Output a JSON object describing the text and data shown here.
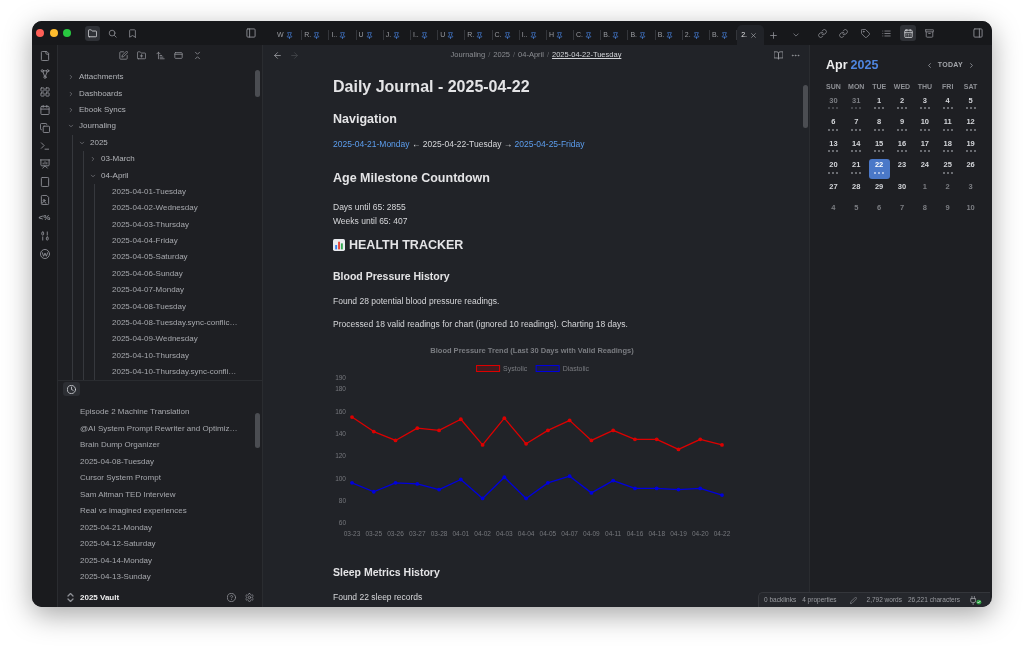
{
  "title_bar": {
    "sidebar_tabs": [
      {
        "selected": true
      },
      {
        "selected": false
      },
      {
        "selected": false
      }
    ],
    "tabs": [
      {
        "label": "W",
        "pinned": true,
        "selected": false
      },
      {
        "label": "R.",
        "pinned": true,
        "selected": false
      },
      {
        "label": "I..",
        "pinned": true,
        "selected": false
      },
      {
        "label": "U",
        "pinned": true,
        "selected": false
      },
      {
        "label": "J.",
        "pinned": true,
        "selected": false
      },
      {
        "label": "I..",
        "pinned": true,
        "selected": false
      },
      {
        "label": "U",
        "pinned": true,
        "selected": false
      },
      {
        "label": "R.",
        "pinned": true,
        "selected": false
      },
      {
        "label": "C.",
        "pinned": true,
        "selected": false
      },
      {
        "label": "I..",
        "pinned": true,
        "selected": false
      },
      {
        "label": "H",
        "pinned": true,
        "selected": false
      },
      {
        "label": "C.",
        "pinned": true,
        "selected": false
      },
      {
        "label": "B.",
        "pinned": true,
        "selected": false
      },
      {
        "label": "B.",
        "pinned": true,
        "selected": false
      },
      {
        "label": "B.",
        "pinned": true,
        "selected": false
      },
      {
        "label": "2.",
        "pinned": true,
        "selected": false
      },
      {
        "label": "B.",
        "pinned": true,
        "selected": false
      },
      {
        "label": "2.",
        "pinned": false,
        "selected": true
      }
    ],
    "right_tabs": [
      {
        "selected": false
      },
      {
        "selected": false
      },
      {
        "selected": false
      },
      {
        "selected": false
      },
      {
        "selected": true
      },
      {
        "selected": false
      }
    ]
  },
  "breadcrumb_bar": {
    "back_enabled": true,
    "forward_enabled": false,
    "items": [
      {
        "label": "Journaling",
        "current": false,
        "separator": "/"
      },
      {
        "label": "2025",
        "current": false,
        "separator": "/"
      },
      {
        "label": "04-April",
        "current": false,
        "separator": "/"
      },
      {
        "label": "2025-04-22-Tuesday",
        "current": true
      }
    ]
  },
  "ribbon": {
    "template_glyph": "<%"
  },
  "file_tree": [
    {
      "label": "Attachments",
      "kind": "folder",
      "expanded": false
    },
    {
      "label": "Dashboards",
      "kind": "folder",
      "expanded": false
    },
    {
      "label": "Ebook Syncs",
      "kind": "folder",
      "expanded": false
    },
    {
      "label": "Journaling",
      "kind": "folder",
      "expanded": true,
      "children": [
        {
          "label": "2025",
          "kind": "folder",
          "expanded": true,
          "children": [
            {
              "label": "03-March",
              "kind": "folder",
              "expanded": false
            },
            {
              "label": "04-April",
              "kind": "folder",
              "expanded": true,
              "children": [
                {
                  "label": "2025-04-01-Tuesday",
                  "kind": "file"
                },
                {
                  "label": "2025-04-02-Wednesday",
                  "kind": "file"
                },
                {
                  "label": "2025-04-03-Thursday",
                  "kind": "file"
                },
                {
                  "label": "2025-04-04-Friday",
                  "kind": "file"
                },
                {
                  "label": "2025-04-05-Saturday",
                  "kind": "file"
                },
                {
                  "label": "2025-04-06-Sunday",
                  "kind": "file"
                },
                {
                  "label": "2025-04-07-Monday",
                  "kind": "file"
                },
                {
                  "label": "2025-04-08-Tuesday",
                  "kind": "file"
                },
                {
                  "label": "2025-04-08-Tuesday.sync-conflic…",
                  "kind": "file"
                },
                {
                  "label": "2025-04-09-Wednesday",
                  "kind": "file"
                },
                {
                  "label": "2025-04-10-Thursday",
                  "kind": "file"
                },
                {
                  "label": "2025-04-10-Thursday.sync-confli…",
                  "kind": "file"
                }
              ]
            }
          ]
        }
      ]
    }
  ],
  "recent_files": {
    "tab_selected": true,
    "items": [
      "Episode 2 Machine Translation",
      "@AI System Prompt Rewriter and Optimiz…",
      "Brain Dump Organizer",
      "2025-04-08-Tuesday",
      "Cursor System Prompt",
      "Sam Altman TED Interview",
      "Real vs imagined experiences",
      "2025-04-21-Monday",
      "2025-04-12-Saturday",
      "2025-04-14-Monday",
      "2025-04-13-Sunday"
    ]
  },
  "vault": {
    "name": "2025 Vault"
  },
  "note": {
    "title": "Daily Journal - 2025-04-22",
    "blocks": [
      {
        "kind": "h2",
        "text": "Navigation"
      },
      {
        "kind": "nav",
        "prev": "2025-04-21-Monday",
        "middle": "← 2025-04-22-Tuesday →",
        "next": "2025-04-25-Friday"
      },
      {
        "kind": "h2",
        "text": "Age Milestone Countdown"
      },
      {
        "kind": "lines",
        "lines": [
          "Days until 65: 2855",
          "Weeks until 65: 407"
        ]
      },
      {
        "kind": "icon_heading",
        "text": "HEALTH TRACKER"
      },
      {
        "kind": "h3",
        "text": "Blood Pressure History"
      },
      {
        "kind": "p",
        "text": "Found 28 potential blood pressure readings."
      },
      {
        "kind": "p",
        "text": "Processed 18 valid readings for chart (ignored 10 readings). Charting 18 days."
      },
      {
        "kind": "chart",
        "chart_data": {
          "type": "line",
          "title": "Blood Pressure Trend (Last 30 Days with Valid Readings)",
          "legend": "top",
          "categories": [
            "03-23",
            "03-25",
            "03-26",
            "03-27",
            "03-28",
            "04-01",
            "04-02",
            "04-03",
            "04-04",
            "04-05",
            "04-07",
            "04-09",
            "04-11",
            "04-16",
            "04-18",
            "04-19",
            "04-20",
            "04-22"
          ],
          "series": [
            {
              "name": "Systolic",
              "color": "#dd0000",
              "values": [
                155,
                142,
                134,
                145,
                143,
                153,
                130,
                154,
                131,
                143,
                152,
                134,
                143,
                135,
                135,
                126,
                135,
                130
              ]
            },
            {
              "name": "Diastolic",
              "color": "#0000dd",
              "values": [
                96,
                88,
                96,
                95,
                90,
                99,
                82,
                101,
                82,
                96,
                102,
                87,
                98,
                91,
                91,
                90,
                91,
                85
              ]
            }
          ],
          "ylim": [
            60,
            190
          ],
          "yticks": [
            60,
            80,
            100,
            120,
            140,
            160,
            180,
            190
          ]
        }
      },
      {
        "kind": "h3",
        "text": "Sleep Metrics History"
      },
      {
        "kind": "p",
        "text": "Found 22 sleep records"
      }
    ]
  },
  "calendar": {
    "month": "Apr",
    "year": "2025",
    "today_button": "TODAY",
    "weekdays": [
      "SUN",
      "MON",
      "TUE",
      "WED",
      "THU",
      "FRI",
      "SAT"
    ],
    "days": [
      {
        "label": "30",
        "outside": true,
        "dots": true,
        "selected": false
      },
      {
        "label": "31",
        "outside": true,
        "dots": true,
        "selected": false
      },
      {
        "label": "1",
        "outside": false,
        "dots": true,
        "selected": false
      },
      {
        "label": "2",
        "outside": false,
        "dots": true,
        "selected": false
      },
      {
        "label": "3",
        "outside": false,
        "dots": true,
        "selected": false
      },
      {
        "label": "4",
        "outside": false,
        "dots": true,
        "selected": false
      },
      {
        "label": "5",
        "outside": false,
        "dots": true,
        "selected": false
      },
      {
        "label": "6",
        "outside": false,
        "dots": true,
        "selected": false
      },
      {
        "label": "7",
        "outside": false,
        "dots": true,
        "selected": false
      },
      {
        "label": "8",
        "outside": false,
        "dots": true,
        "selected": false
      },
      {
        "label": "9",
        "outside": false,
        "dots": true,
        "selected": false
      },
      {
        "label": "10",
        "outside": false,
        "dots": true,
        "selected": false
      },
      {
        "label": "11",
        "outside": false,
        "dots": true,
        "selected": false
      },
      {
        "label": "12",
        "outside": false,
        "dots": true,
        "selected": false
      },
      {
        "label": "13",
        "outside": false,
        "dots": true,
        "selected": false
      },
      {
        "label": "14",
        "outside": false,
        "dots": true,
        "selected": false
      },
      {
        "label": "15",
        "outside": false,
        "dots": true,
        "selected": false
      },
      {
        "label": "16",
        "outside": false,
        "dots": true,
        "selected": false
      },
      {
        "label": "17",
        "outside": false,
        "dots": true,
        "selected": false
      },
      {
        "label": "18",
        "outside": false,
        "dots": true,
        "selected": false
      },
      {
        "label": "19",
        "outside": false,
        "dots": true,
        "selected": false
      },
      {
        "label": "20",
        "outside": false,
        "dots": true,
        "selected": false
      },
      {
        "label": "21",
        "outside": false,
        "dots": true,
        "selected": false
      },
      {
        "label": "22",
        "outside": false,
        "dots": true,
        "selected": true
      },
      {
        "label": "23",
        "outside": false,
        "dots": false,
        "selected": false
      },
      {
        "label": "24",
        "outside": false,
        "dots": false,
        "selected": false
      },
      {
        "label": "25",
        "outside": false,
        "dots": true,
        "selected": false
      },
      {
        "label": "26",
        "outside": false,
        "dots": false,
        "selected": false
      },
      {
        "label": "27",
        "outside": false,
        "dots": false,
        "selected": false
      },
      {
        "label": "28",
        "outside": false,
        "dots": false,
        "selected": false
      },
      {
        "label": "29",
        "outside": false,
        "dots": false,
        "selected": false
      },
      {
        "label": "30",
        "outside": false,
        "dots": false,
        "selected": false
      },
      {
        "label": "1",
        "outside": true,
        "dots": false,
        "selected": false
      },
      {
        "label": "2",
        "outside": true,
        "dots": false,
        "selected": false
      },
      {
        "label": "3",
        "outside": true,
        "dots": false,
        "selected": false
      },
      {
        "label": "4",
        "outside": true,
        "dots": false,
        "selected": false
      },
      {
        "label": "5",
        "outside": true,
        "dots": false,
        "selected": false
      },
      {
        "label": "6",
        "outside": true,
        "dots": false,
        "selected": false
      },
      {
        "label": "7",
        "outside": true,
        "dots": false,
        "selected": false
      },
      {
        "label": "8",
        "outside": true,
        "dots": false,
        "selected": false
      },
      {
        "label": "9",
        "outside": true,
        "dots": false,
        "selected": false
      },
      {
        "label": "10",
        "outside": true,
        "dots": false,
        "selected": false
      }
    ]
  },
  "status_bar": {
    "backlinks": "0 backlinks",
    "properties": "4 properties",
    "words": "2,792 words",
    "characters": "26,221 characters"
  }
}
